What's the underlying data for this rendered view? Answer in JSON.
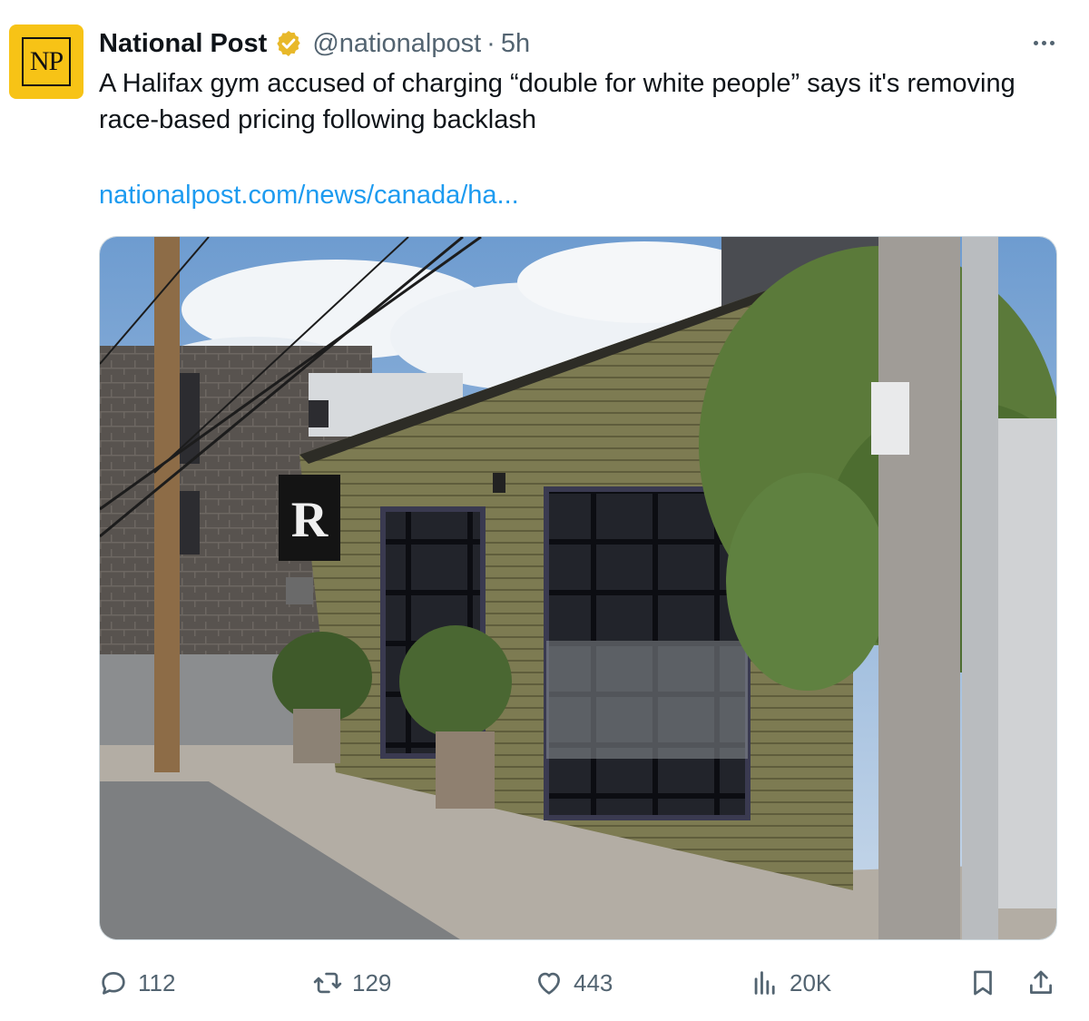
{
  "post": {
    "author": {
      "name": "National Post",
      "handle": "@nationalpost",
      "avatar_initials": "NP",
      "avatar_color": "#f7c316"
    },
    "separator": "·",
    "time": "5h",
    "text": "A Halifax gym accused of charging “double for white people” says it's removing race-based pricing following backlash",
    "link_text": "nationalpost.com/news/canada/ha...",
    "media": {
      "sign_letter": "R"
    },
    "actions": {
      "replies": "112",
      "reposts": "129",
      "likes": "443",
      "views": "20K"
    }
  },
  "colors": {
    "link": "#1d9bf0",
    "secondary_text": "#536471",
    "verified_badge": "#e8b829"
  }
}
